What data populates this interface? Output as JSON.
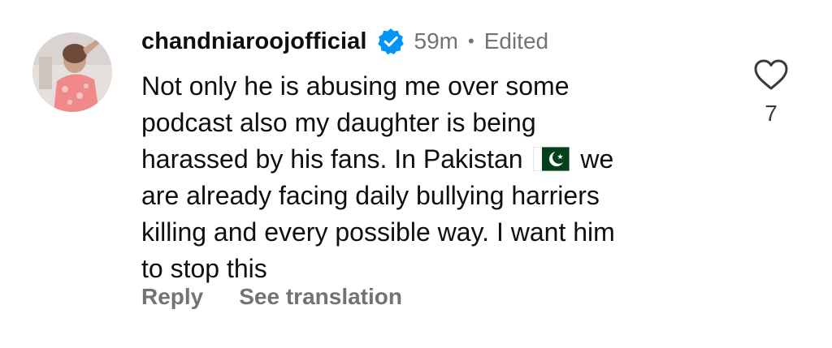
{
  "comment": {
    "username": "chandniaroojofficial",
    "verified": true,
    "time": "59m",
    "separator": "•",
    "edited_label": "Edited",
    "text_lines": [
      "Not only he is abusing me over some",
      "podcast also my daughter is being",
      "harassed by his fans. In Pakistan",
      "we",
      "are already facing daily bullying harriers",
      "killing and every possible way. I want him",
      "to stop this"
    ],
    "flag_emoji": "pakistan-flag-icon",
    "like_count": "7",
    "actions": {
      "reply": "Reply",
      "see_translation": "See translation"
    }
  },
  "colors": {
    "text": "#0f0f0f",
    "secondary": "#737373",
    "verified_blue": "#0095f6",
    "flag_green": "#01411c"
  }
}
